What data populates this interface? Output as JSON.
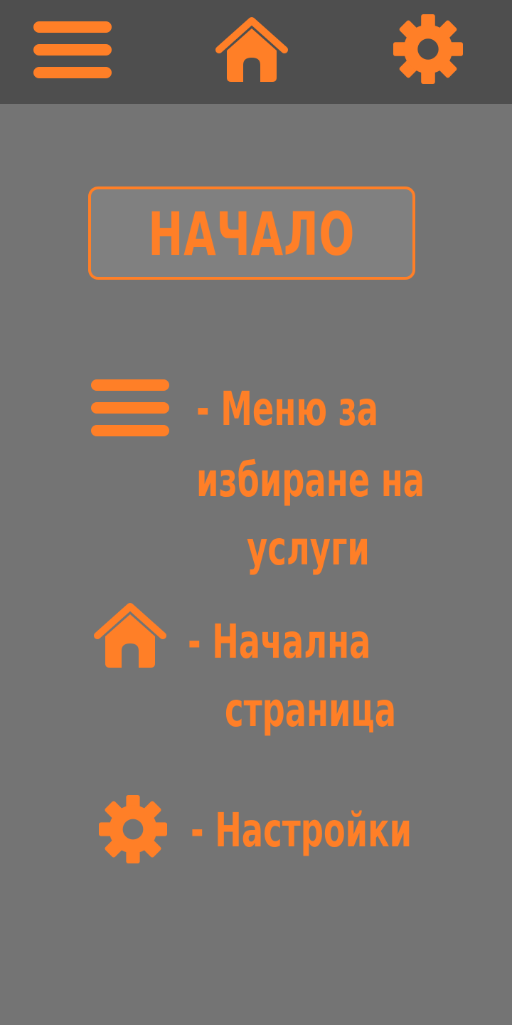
{
  "colors": {
    "accent": "#ff7f27",
    "topbar_bg": "#4e4e4e",
    "page_bg": "#747474",
    "title_box_bg": "#808080"
  },
  "topbar": {
    "icons": [
      "hamburger-menu-icon",
      "home-icon",
      "gear-icon"
    ]
  },
  "title": {
    "text": "НАЧАЛО"
  },
  "legend": {
    "menu": {
      "icon": "hamburger-menu-icon",
      "line1": "-  Меню за",
      "line2": "избиране на",
      "line3": "услуги"
    },
    "home": {
      "icon": "home-icon",
      "line1": "-   Начална",
      "line2": "страница"
    },
    "settings": {
      "icon": "gear-icon",
      "line1": "-  Настройки"
    }
  }
}
